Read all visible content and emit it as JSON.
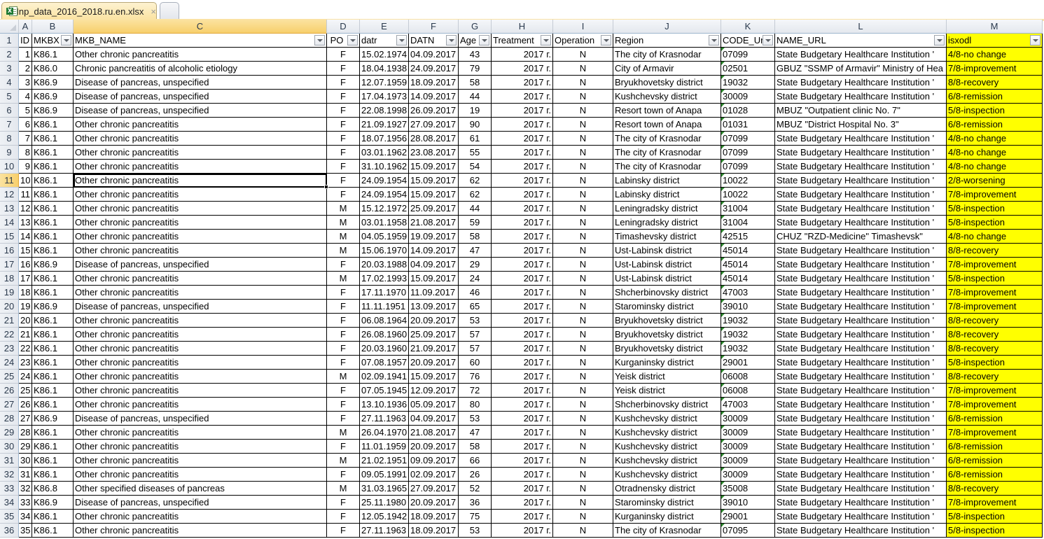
{
  "window": {
    "tab_active": "Inp_data_2016_2018.ru.en.xlsx",
    "tab_close": "×"
  },
  "sheet": {
    "column_letters": [
      "A",
      "B",
      "C",
      "D",
      "E",
      "F",
      "G",
      "H",
      "I",
      "J",
      "K",
      "L",
      "M"
    ],
    "selected_column": "C",
    "selected_row": 11,
    "headers": [
      "ID",
      "MKBX",
      "MKB_NAME",
      "PO",
      "datr",
      "DATN",
      "Age",
      "Treatment",
      "Operation",
      "Region",
      "CODE_Ur",
      "NAME_URL",
      "isxodl"
    ],
    "header_filters": [
      false,
      true,
      true,
      true,
      true,
      true,
      true,
      true,
      true,
      true,
      true,
      true,
      true
    ],
    "highlight_color": "#ffff00",
    "rows": [
      [
        "1",
        "K86.1",
        "Other chronic pancreatitis",
        "F",
        "15.02.1974",
        "04.09.2017",
        "43",
        "2017 г.",
        "N",
        "The city of Krasnodar",
        "07099",
        "State Budgetary Healthcare Institution '",
        "4/8-no change"
      ],
      [
        "2",
        "K86.0",
        "Chronic pancreatitis of alcoholic etiology",
        "F",
        "18.04.1938",
        "24.09.2017",
        "79",
        "2017 г.",
        "N",
        "City of Armavir",
        "02501",
        "GBUZ \"SSMP of Armavir\" Ministry of Hea",
        "7/8-improvement"
      ],
      [
        "3",
        "K86.9",
        "Disease of pancreas, unspecified",
        "F",
        "12.07.1959",
        "18.09.2017",
        "58",
        "2017 г.",
        "N",
        "Bryukhovetsky district",
        "19032",
        "State Budgetary Healthcare Institution '",
        "8/8-recovery"
      ],
      [
        "4",
        "K86.9",
        "Disease of pancreas, unspecified",
        "F",
        "17.04.1973",
        "14.09.2017",
        "44",
        "2017 г.",
        "N",
        "Kushchevsky district",
        "30009",
        "State Budgetary Healthcare Institution '",
        "6/8-remission"
      ],
      [
        "5",
        "K86.9",
        "Disease of pancreas, unspecified",
        "F",
        "22.08.1998",
        "26.09.2017",
        "19",
        "2017 г.",
        "N",
        "Resort town of Anapa",
        "01028",
        "MBUZ \"Outpatient clinic No. 7\"",
        "5/8-inspection"
      ],
      [
        "6",
        "K86.1",
        "Other chronic pancreatitis",
        "F",
        "21.09.1927",
        "27.09.2017",
        "90",
        "2017 г.",
        "N",
        "Resort town of Anapa",
        "01031",
        "MBUZ \"District Hospital No. 3\"",
        "6/8-remission"
      ],
      [
        "7",
        "K86.1",
        "Other chronic pancreatitis",
        "F",
        "18.07.1956",
        "28.08.2017",
        "61",
        "2017 г.",
        "N",
        "The city of Krasnodar",
        "07099",
        "State Budgetary Healthcare Institution '",
        "4/8-no change"
      ],
      [
        "8",
        "K86.1",
        "Other chronic pancreatitis",
        "F",
        "03.01.1962",
        "23.08.2017",
        "55",
        "2017 г.",
        "N",
        "The city of Krasnodar",
        "07099",
        "State Budgetary Healthcare Institution '",
        "4/8-no change"
      ],
      [
        "9",
        "K86.1",
        "Other chronic pancreatitis",
        "F",
        "31.10.1962",
        "15.09.2017",
        "54",
        "2017 г.",
        "N",
        "The city of Krasnodar",
        "07099",
        "State Budgetary Healthcare Institution '",
        "4/8-no change"
      ],
      [
        "10",
        "K86.1",
        "Other chronic pancreatitis",
        "F",
        "24.09.1954",
        "15.09.2017",
        "62",
        "2017 г.",
        "N",
        "Labinsky district",
        "10022",
        "State Budgetary Healthcare Institution '",
        "2/8-worsening"
      ],
      [
        "11",
        "K86.1",
        "Other chronic pancreatitis",
        "F",
        "24.09.1954",
        "15.09.2017",
        "62",
        "2017 г.",
        "N",
        "Labinsky district",
        "10022",
        "State Budgetary Healthcare Institution '",
        "7/8-improvement"
      ],
      [
        "12",
        "K86.1",
        "Other chronic pancreatitis",
        "M",
        "15.12.1972",
        "25.09.2017",
        "44",
        "2017 г.",
        "N",
        "Leningradsky district",
        "31004",
        "State Budgetary Healthcare Institution '",
        "5/8-inspection"
      ],
      [
        "13",
        "K86.1",
        "Other chronic pancreatitis",
        "M",
        "03.01.1958",
        "21.08.2017",
        "59",
        "2017 г.",
        "N",
        "Leningradsky district",
        "31004",
        "State Budgetary Healthcare Institution '",
        "5/8-inspection"
      ],
      [
        "14",
        "K86.1",
        "Other chronic pancreatitis",
        "M",
        "04.05.1959",
        "19.09.2017",
        "58",
        "2017 г.",
        "N",
        "Timashevsky district",
        "42515",
        "CHUZ \"RZD-Medicine\" Timashevsk\"",
        "4/8-no change"
      ],
      [
        "15",
        "K86.1",
        "Other chronic pancreatitis",
        "M",
        "15.06.1970",
        "14.09.2017",
        "47",
        "2017 г.",
        "N",
        "Ust-Labinsk district",
        "45014",
        "State Budgetary Healthcare Institution '",
        "8/8-recovery"
      ],
      [
        "16",
        "K86.9",
        "Disease of pancreas, unspecified",
        "F",
        "20.03.1988",
        "04.09.2017",
        "29",
        "2017 г.",
        "N",
        "Ust-Labinsk district",
        "45014",
        "State Budgetary Healthcare Institution '",
        "7/8-improvement"
      ],
      [
        "17",
        "K86.1",
        "Other chronic pancreatitis",
        "M",
        "17.02.1993",
        "15.09.2017",
        "24",
        "2017 г.",
        "N",
        "Ust-Labinsk district",
        "45014",
        "State Budgetary Healthcare Institution '",
        "5/8-inspection"
      ],
      [
        "18",
        "K86.1",
        "Other chronic pancreatitis",
        "F",
        "17.11.1970",
        "11.09.2017",
        "46",
        "2017 г.",
        "N",
        "Shcherbinovsky district",
        "47003",
        "State Budgetary Healthcare Institution '",
        "7/8-improvement"
      ],
      [
        "19",
        "K86.9",
        "Disease of pancreas, unspecified",
        "F",
        "11.11.1951",
        "13.09.2017",
        "65",
        "2017 г.",
        "N",
        "Starominsky district",
        "39010",
        "State Budgetary Healthcare Institution '",
        "7/8-improvement"
      ],
      [
        "20",
        "K86.1",
        "Other chronic pancreatitis",
        "F",
        "06.08.1964",
        "20.09.2017",
        "53",
        "2017 г.",
        "N",
        "Bryukhovetsky district",
        "19032",
        "State Budgetary Healthcare Institution '",
        "8/8-recovery"
      ],
      [
        "21",
        "K86.1",
        "Other chronic pancreatitis",
        "F",
        "26.08.1960",
        "25.09.2017",
        "57",
        "2017 г.",
        "N",
        "Bryukhovetsky district",
        "19032",
        "State Budgetary Healthcare Institution '",
        "8/8-recovery"
      ],
      [
        "22",
        "K86.1",
        "Other chronic pancreatitis",
        "F",
        "20.03.1960",
        "21.09.2017",
        "57",
        "2017 г.",
        "N",
        "Bryukhovetsky district",
        "19032",
        "State Budgetary Healthcare Institution '",
        "8/8-recovery"
      ],
      [
        "23",
        "K86.1",
        "Other chronic pancreatitis",
        "F",
        "07.08.1957",
        "20.09.2017",
        "60",
        "2017 г.",
        "N",
        "Kurganinsky district",
        "29001",
        "State Budgetary Healthcare Institution '",
        "5/8-inspection"
      ],
      [
        "24",
        "K86.1",
        "Other chronic pancreatitis",
        "M",
        "02.09.1941",
        "15.09.2017",
        "76",
        "2017 г.",
        "N",
        "Yeisk district",
        "06008",
        "State Budgetary Healthcare Institution '",
        "8/8-recovery"
      ],
      [
        "25",
        "K86.1",
        "Other chronic pancreatitis",
        "F",
        "07.05.1945",
        "12.09.2017",
        "72",
        "2017 г.",
        "N",
        "Yeisk district",
        "06008",
        "State Budgetary Healthcare Institution '",
        "7/8-improvement"
      ],
      [
        "26",
        "K86.1",
        "Other chronic pancreatitis",
        "F",
        "13.10.1936",
        "05.09.2017",
        "80",
        "2017 г.",
        "N",
        "Shcherbinovsky district",
        "47003",
        "State Budgetary Healthcare Institution '",
        "7/8-improvement"
      ],
      [
        "27",
        "K86.9",
        "Disease of pancreas, unspecified",
        "F",
        "27.11.1963",
        "04.09.2017",
        "53",
        "2017 г.",
        "N",
        "Kushchevsky district",
        "30009",
        "State Budgetary Healthcare Institution '",
        "6/8-remission"
      ],
      [
        "28",
        "K86.1",
        "Other chronic pancreatitis",
        "M",
        "26.04.1970",
        "21.08.2017",
        "47",
        "2017 г.",
        "N",
        "Kushchevsky district",
        "30009",
        "State Budgetary Healthcare Institution '",
        "7/8-improvement"
      ],
      [
        "29",
        "K86.1",
        "Other chronic pancreatitis",
        "F",
        "11.01.1959",
        "20.09.2017",
        "58",
        "2017 г.",
        "N",
        "Kushchevsky district",
        "30009",
        "State Budgetary Healthcare Institution '",
        "6/8-remission"
      ],
      [
        "30",
        "K86.1",
        "Other chronic pancreatitis",
        "M",
        "21.02.1951",
        "09.09.2017",
        "66",
        "2017 г.",
        "N",
        "Kushchevsky district",
        "30009",
        "State Budgetary Healthcare Institution '",
        "6/8-remission"
      ],
      [
        "31",
        "K86.1",
        "Other chronic pancreatitis",
        "F",
        "09.05.1991",
        "02.09.2017",
        "26",
        "2017 г.",
        "N",
        "Kushchevsky district",
        "30009",
        "State Budgetary Healthcare Institution '",
        "6/8-remission"
      ],
      [
        "32",
        "K86.8",
        "Other specified diseases of pancreas",
        "M",
        "31.03.1965",
        "27.09.2017",
        "52",
        "2017 г.",
        "N",
        "Otradnensky district",
        "35008",
        "State Budgetary Healthcare Institution '",
        "8/8-recovery"
      ],
      [
        "33",
        "K86.9",
        "Disease of pancreas, unspecified",
        "F",
        "25.11.1980",
        "20.09.2017",
        "36",
        "2017 г.",
        "N",
        "Starominsky district",
        "39010",
        "State Budgetary Healthcare Institution '",
        "7/8-improvement"
      ],
      [
        "34",
        "K86.1",
        "Other chronic pancreatitis",
        "F",
        "12.05.1942",
        "18.09.2017",
        "75",
        "2017 г.",
        "N",
        "Kurganinsky district",
        "29001",
        "State Budgetary Healthcare Institution '",
        "5/8-inspection"
      ],
      [
        "35",
        "K86.1",
        "Other chronic pancreatitis",
        "F",
        "27.11.1963",
        "18.09.2017",
        "53",
        "2017 г.",
        "N",
        "The city of Krasnodar",
        "07095",
        "State Budgetary Healthcare Institution '",
        "5/8-inspection"
      ]
    ]
  }
}
